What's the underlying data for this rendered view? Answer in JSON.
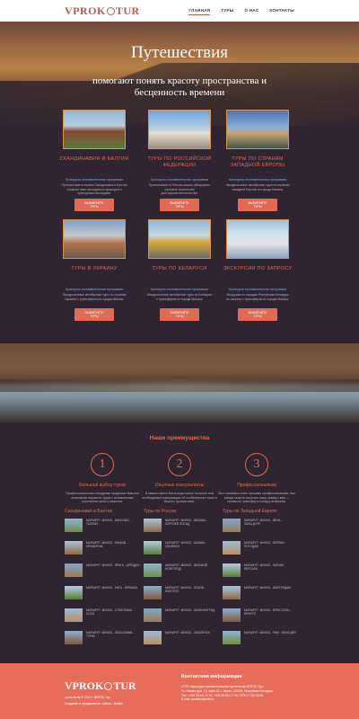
{
  "header": {
    "logo_left": "VPROK",
    "logo_right": "TUR",
    "nav": [
      "ГЛАВНАЯ",
      "ТУРЫ",
      "О НАС",
      "КОНТАКТЫ"
    ]
  },
  "hero": {
    "title": "Путешествия",
    "subtitle": "помогают понять красоту пространства и бесценность времени"
  },
  "tours": [
    {
      "title": "СКАНДИНАВИЯ И БАЛТИЯ",
      "program": "Культурно-познавательная программа",
      "desc": "Путешествие в страны Скандинавии и Балтии позволит вам насладиться природой и культурным наследием.",
      "button": "ВЫБИРАЙТЕ ТУРЫ"
    },
    {
      "title": "ТУРЫ ПО РОССИЙСКОЙ ФЕДЕРАЦИИ",
      "program": "Культурно-познавательная программа",
      "desc": "Путешествие по России можно обнаружить огромное количество достопримечательностей.",
      "button": "ВЫБИРАЙТЕ ТУРЫ"
    },
    {
      "title": "ТУРЫ ПО СТРАНАМ ЗАПАДНОЙ ЕВРОПЫ",
      "program": "Культурно-познавательная программа",
      "desc": "Экскурсионные автобусные туры по странам западной Европы из города Минска.",
      "button": "ВЫБИРАЙТЕ ТУРЫ"
    },
    {
      "title": "ТУРЫ В УКРАИНУ",
      "program": "Культурно-познавательная программа",
      "desc": "Экскурсионные автобусные туры по странам Украины с трансфером из города Минска.",
      "button": "ВЫБИРАЙТЕ ТУРЫ"
    },
    {
      "title": "ТУРЫ ПО БЕЛАРУСИ",
      "program": "Культурно-познавательная программа",
      "desc": "Экскурсионные автобусные туры по Беларуси с трансфером из города Минска.",
      "button": "ВЫБИРАЙТЕ ТУРЫ"
    },
    {
      "title": "ЭКСКУРСИИ ПО ЗАПРОСУ",
      "program": "Культурно-познавательная программа",
      "desc": "Экскурсии по городам Республики Беларусь по запросу с трансфером из города Минска.",
      "button": "ВЫБИРАЙТЕ ТУРЫ"
    }
  ],
  "advantages": {
    "title": "Наши преимущества",
    "items": [
      {
        "num": "1",
        "name": "Большой выбор туров",
        "text": "Профессиональная сотрудники продолжат Вам все возможные варианты туров с оптимальным сочетанием цены и качества."
      },
      {
        "num": "2",
        "name": "Опытные консультанты",
        "text": "В нашем офисе Вас всегда смогут получить всю необходимую информацию об особенностях стран и Вашего путешествия."
      },
      {
        "num": "3",
        "name": "Профессионализм",
        "text": "Мы стремимся стать лучшими профессионалами. Как всегда можете получить вашу заявку к вам — стоимость трансфер в поездку включены."
      }
    ]
  },
  "lists": [
    {
      "head": "Скандинавия и Балтия",
      "items": [
        "МАРШРУТ: МИНСК - ВИЛЬНЮС - ТАЛЛИН",
        "МАРШРУТ: МИНСК - КРАКОВ - КРОМЕРИЖ",
        "МАРШРУТ: МИНСК - ПРАГА - ДРЕЗДЕН",
        "МАРШРУТ: МИНСК - РИГА - ЮРМАЛА",
        "МАРШРУТ: МИНСК - СТОКГОЛЬМ - ОСЛО",
        "МАРШРУТ: МИНСК - ХЕЛЬСИНКИ - ТУРКУ"
      ]
    },
    {
      "head": "Туры по России",
      "items": [
        "МАРШРУТ: МИНСК - МОСКВА - СЕРГИЕВ ПОСАД",
        "МАРШРУТ: МИНСК - КАЗАНЬ - СВИЯЖСК",
        "МАРШРУТ: МИНСК - ВЕЛИКИЙ НОВГОРОД",
        "МАРШРУТ: МИНСК - ПСКОВ - ИЗБОРСК",
        "МАРШРУТ: МИНСК - КАЛИНИНГРАД",
        "МАРШРУТ: МИНСК - СМОЛЕНСК"
      ]
    },
    {
      "head": "Туры по Западной Европе",
      "items": [
        "МАРШРУТ: МИНСК - ВЕНА - ЗАЛЬЦБУРГ",
        "МАРШРУТ: МИНСК - БЕРЛИН - ПОТСДАМ",
        "МАРШРУТ: МИНСК - ПАРИЖ - ВЕРСАЛЬ",
        "МАРШРУТ: МИНСК - АМСТЕРДАМ",
        "МАРШРУТ: МИНСК - БРЮССЕЛЬ - БРЮГГЕ",
        "МАРШРУТ: МИНСК - РИМ - ВЕНЕЦИЯ"
      ]
    }
  ],
  "footer": {
    "logo_left": "VPROK",
    "logo_right": "TUR",
    "copyright": "vprok-tur.by © 2019 • ВПРОК Тур",
    "made_by": "Создание и продвижение сайтов - BelBel",
    "contact_head": "Контактная информация",
    "contact_lines": [
      "ЧТУП «Культурно-просветительная турагентство ВПРОК Тур»",
      "Ул. Немиги дом. 13, офис 22, г. Минск, 220004, Республика Беларусь",
      "Тел.: +375 29 641 11 96, +375 25 944 11 96, +375 17 200 80 88",
      "E-mail: vprokbur@mail.ru"
    ]
  }
}
